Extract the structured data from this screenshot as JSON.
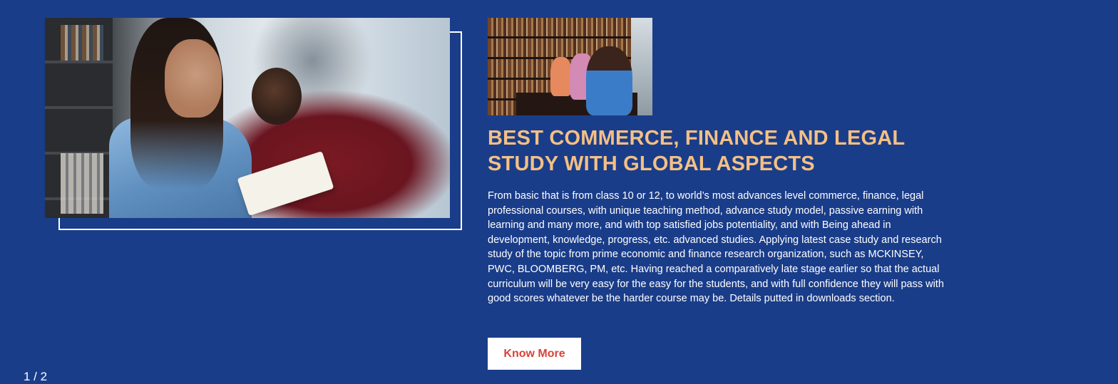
{
  "hero": {
    "title": "BEST COMMERCE, FINANCE AND LEGAL STUDY WITH GLOBAL ASPECTS",
    "description": "From basic that is from class 10 or 12, to world’s most advances level commerce, finance, legal professional courses, with unique teaching method, advance study model, passive earning with learning and many more, and with top satisfied jobs potentiality, and with Being ahead in development, knowledge, progress, etc. advanced studies. Applying latest case study and research study of the topic from prime economic and finance research organization, such as MCKINSEY, PWC, BLOOMBERG, PM, etc. Having reached a comparatively late stage earlier so that the actual curriculum will be very easy for the easy for the students, and with full confidence they will pass with good scores whatever be the harder course may be. Details putted in downloads section.",
    "cta_label": "Know More"
  },
  "slider": {
    "counter": "1 / 2"
  },
  "colors": {
    "background": "#1a3d8a",
    "title": "#f4c084",
    "button_text": "#d9423a",
    "button_bg": "#ffffff"
  }
}
